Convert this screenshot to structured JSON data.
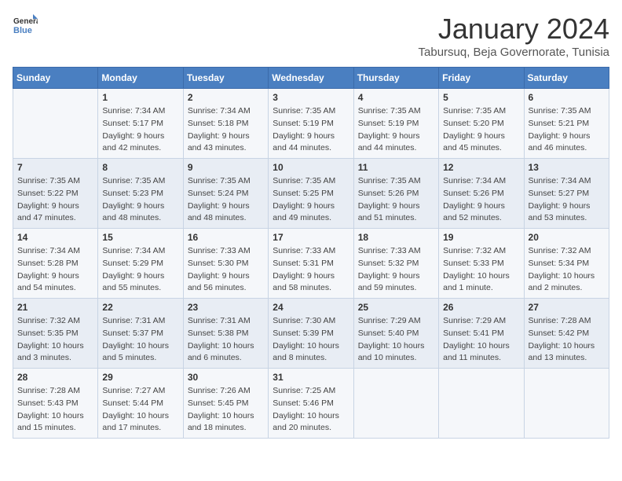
{
  "header": {
    "logo_line1": "General",
    "logo_line2": "Blue",
    "month_title": "January 2024",
    "subtitle": "Tabursuq, Beja Governorate, Tunisia"
  },
  "weekdays": [
    "Sunday",
    "Monday",
    "Tuesday",
    "Wednesday",
    "Thursday",
    "Friday",
    "Saturday"
  ],
  "weeks": [
    [
      {
        "day": "",
        "sunrise": "",
        "sunset": "",
        "daylight": ""
      },
      {
        "day": "1",
        "sunrise": "Sunrise: 7:34 AM",
        "sunset": "Sunset: 5:17 PM",
        "daylight": "Daylight: 9 hours and 42 minutes."
      },
      {
        "day": "2",
        "sunrise": "Sunrise: 7:34 AM",
        "sunset": "Sunset: 5:18 PM",
        "daylight": "Daylight: 9 hours and 43 minutes."
      },
      {
        "day": "3",
        "sunrise": "Sunrise: 7:35 AM",
        "sunset": "Sunset: 5:19 PM",
        "daylight": "Daylight: 9 hours and 44 minutes."
      },
      {
        "day": "4",
        "sunrise": "Sunrise: 7:35 AM",
        "sunset": "Sunset: 5:19 PM",
        "daylight": "Daylight: 9 hours and 44 minutes."
      },
      {
        "day": "5",
        "sunrise": "Sunrise: 7:35 AM",
        "sunset": "Sunset: 5:20 PM",
        "daylight": "Daylight: 9 hours and 45 minutes."
      },
      {
        "day": "6",
        "sunrise": "Sunrise: 7:35 AM",
        "sunset": "Sunset: 5:21 PM",
        "daylight": "Daylight: 9 hours and 46 minutes."
      }
    ],
    [
      {
        "day": "7",
        "sunrise": "Sunrise: 7:35 AM",
        "sunset": "Sunset: 5:22 PM",
        "daylight": "Daylight: 9 hours and 47 minutes."
      },
      {
        "day": "8",
        "sunrise": "Sunrise: 7:35 AM",
        "sunset": "Sunset: 5:23 PM",
        "daylight": "Daylight: 9 hours and 48 minutes."
      },
      {
        "day": "9",
        "sunrise": "Sunrise: 7:35 AM",
        "sunset": "Sunset: 5:24 PM",
        "daylight": "Daylight: 9 hours and 48 minutes."
      },
      {
        "day": "10",
        "sunrise": "Sunrise: 7:35 AM",
        "sunset": "Sunset: 5:25 PM",
        "daylight": "Daylight: 9 hours and 49 minutes."
      },
      {
        "day": "11",
        "sunrise": "Sunrise: 7:35 AM",
        "sunset": "Sunset: 5:26 PM",
        "daylight": "Daylight: 9 hours and 51 minutes."
      },
      {
        "day": "12",
        "sunrise": "Sunrise: 7:34 AM",
        "sunset": "Sunset: 5:26 PM",
        "daylight": "Daylight: 9 hours and 52 minutes."
      },
      {
        "day": "13",
        "sunrise": "Sunrise: 7:34 AM",
        "sunset": "Sunset: 5:27 PM",
        "daylight": "Daylight: 9 hours and 53 minutes."
      }
    ],
    [
      {
        "day": "14",
        "sunrise": "Sunrise: 7:34 AM",
        "sunset": "Sunset: 5:28 PM",
        "daylight": "Daylight: 9 hours and 54 minutes."
      },
      {
        "day": "15",
        "sunrise": "Sunrise: 7:34 AM",
        "sunset": "Sunset: 5:29 PM",
        "daylight": "Daylight: 9 hours and 55 minutes."
      },
      {
        "day": "16",
        "sunrise": "Sunrise: 7:33 AM",
        "sunset": "Sunset: 5:30 PM",
        "daylight": "Daylight: 9 hours and 56 minutes."
      },
      {
        "day": "17",
        "sunrise": "Sunrise: 7:33 AM",
        "sunset": "Sunset: 5:31 PM",
        "daylight": "Daylight: 9 hours and 58 minutes."
      },
      {
        "day": "18",
        "sunrise": "Sunrise: 7:33 AM",
        "sunset": "Sunset: 5:32 PM",
        "daylight": "Daylight: 9 hours and 59 minutes."
      },
      {
        "day": "19",
        "sunrise": "Sunrise: 7:32 AM",
        "sunset": "Sunset: 5:33 PM",
        "daylight": "Daylight: 10 hours and 1 minute."
      },
      {
        "day": "20",
        "sunrise": "Sunrise: 7:32 AM",
        "sunset": "Sunset: 5:34 PM",
        "daylight": "Daylight: 10 hours and 2 minutes."
      }
    ],
    [
      {
        "day": "21",
        "sunrise": "Sunrise: 7:32 AM",
        "sunset": "Sunset: 5:35 PM",
        "daylight": "Daylight: 10 hours and 3 minutes."
      },
      {
        "day": "22",
        "sunrise": "Sunrise: 7:31 AM",
        "sunset": "Sunset: 5:37 PM",
        "daylight": "Daylight: 10 hours and 5 minutes."
      },
      {
        "day": "23",
        "sunrise": "Sunrise: 7:31 AM",
        "sunset": "Sunset: 5:38 PM",
        "daylight": "Daylight: 10 hours and 6 minutes."
      },
      {
        "day": "24",
        "sunrise": "Sunrise: 7:30 AM",
        "sunset": "Sunset: 5:39 PM",
        "daylight": "Daylight: 10 hours and 8 minutes."
      },
      {
        "day": "25",
        "sunrise": "Sunrise: 7:29 AM",
        "sunset": "Sunset: 5:40 PM",
        "daylight": "Daylight: 10 hours and 10 minutes."
      },
      {
        "day": "26",
        "sunrise": "Sunrise: 7:29 AM",
        "sunset": "Sunset: 5:41 PM",
        "daylight": "Daylight: 10 hours and 11 minutes."
      },
      {
        "day": "27",
        "sunrise": "Sunrise: 7:28 AM",
        "sunset": "Sunset: 5:42 PM",
        "daylight": "Daylight: 10 hours and 13 minutes."
      }
    ],
    [
      {
        "day": "28",
        "sunrise": "Sunrise: 7:28 AM",
        "sunset": "Sunset: 5:43 PM",
        "daylight": "Daylight: 10 hours and 15 minutes."
      },
      {
        "day": "29",
        "sunrise": "Sunrise: 7:27 AM",
        "sunset": "Sunset: 5:44 PM",
        "daylight": "Daylight: 10 hours and 17 minutes."
      },
      {
        "day": "30",
        "sunrise": "Sunrise: 7:26 AM",
        "sunset": "Sunset: 5:45 PM",
        "daylight": "Daylight: 10 hours and 18 minutes."
      },
      {
        "day": "31",
        "sunrise": "Sunrise: 7:25 AM",
        "sunset": "Sunset: 5:46 PM",
        "daylight": "Daylight: 10 hours and 20 minutes."
      },
      {
        "day": "",
        "sunrise": "",
        "sunset": "",
        "daylight": ""
      },
      {
        "day": "",
        "sunrise": "",
        "sunset": "",
        "daylight": ""
      },
      {
        "day": "",
        "sunrise": "",
        "sunset": "",
        "daylight": ""
      }
    ]
  ]
}
